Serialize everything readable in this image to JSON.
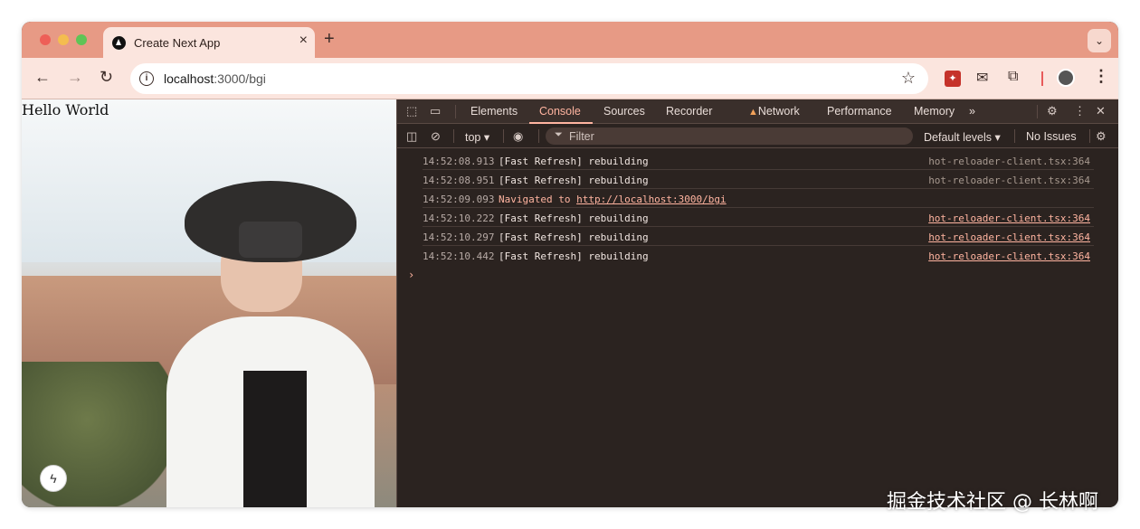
{
  "browser": {
    "tab_title": "Create Next App",
    "tab_close": "×",
    "new_tab": "+",
    "tab_search_icon": "⌄",
    "url_host": "localhost",
    "url_path": ":3000/bgi",
    "nav_back": "←",
    "nav_forward": "→",
    "nav_reload": "↻",
    "star": "☆",
    "menu": "⋮"
  },
  "page": {
    "heading": "Hello World",
    "bolt": "ϟ"
  },
  "devtools": {
    "tabs": [
      "Elements",
      "Console",
      "Sources",
      "Recorder",
      "Network",
      "Performance",
      "Memory"
    ],
    "more": "»",
    "context": "top ▾",
    "filter_placeholder": "Filter",
    "filter_icon": "⏷",
    "levels": "Default levels ▾",
    "issues": "No Issues",
    "logs": [
      {
        "time": "14:52:08.913",
        "msg": "[Fast Refresh] rebuilding",
        "src": "hot-reloader-client.tsx:364"
      },
      {
        "time": "14:52:08.951",
        "msg": "[Fast Refresh] rebuilding",
        "src": "hot-reloader-client.tsx:364"
      },
      {
        "time": "14:52:09.093",
        "msg_prefix": "Navigated to ",
        "link": "http://localhost:3000/bgi"
      },
      {
        "time": "14:52:10.222",
        "msg": "[Fast Refresh] rebuilding",
        "src": "hot-reloader-client.tsx:364"
      },
      {
        "time": "14:52:10.297",
        "msg": "[Fast Refresh] rebuilding",
        "src": "hot-reloader-client.tsx:364"
      },
      {
        "time": "14:52:10.442",
        "msg": "[Fast Refresh] rebuilding",
        "src": "hot-reloader-client.tsx:364"
      }
    ],
    "prompt": "›"
  },
  "watermark": "掘金技术社区 @ 长林啊"
}
